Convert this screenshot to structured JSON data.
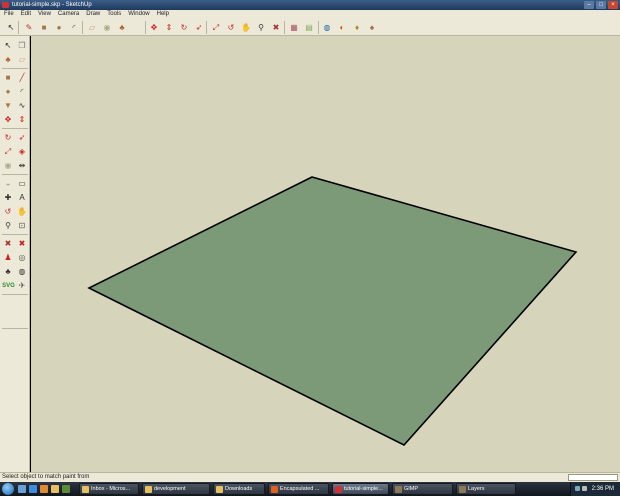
{
  "window": {
    "title": "tutorial-simple.skp - SketchUp"
  },
  "menu": [
    "File",
    "Edit",
    "View",
    "Camera",
    "Draw",
    "Tools",
    "Window",
    "Help"
  ],
  "toolbar_top": [
    {
      "icon": "select-icon",
      "glyph": "↖",
      "color": "#222"
    },
    {
      "icon": "pencil-icon",
      "glyph": "✎",
      "color": "#b33"
    },
    {
      "icon": "rectangle-icon",
      "glyph": "■",
      "color": "#a6764a"
    },
    {
      "icon": "circle-icon",
      "glyph": "●",
      "color": "#a6764a"
    },
    {
      "icon": "arc-icon",
      "glyph": "◜",
      "color": "#333"
    },
    {
      "icon": "eraser-icon",
      "glyph": "▱",
      "color": "#d88"
    },
    {
      "icon": "tape-measure-icon",
      "glyph": "◉",
      "color": "#aa8"
    },
    {
      "icon": "paint-bucket-icon",
      "glyph": "♣",
      "color": "#a63"
    },
    {
      "icon": "move-icon",
      "glyph": "✥",
      "color": "#c22"
    },
    {
      "icon": "push-pull-icon",
      "glyph": "⇕",
      "color": "#c22"
    },
    {
      "icon": "rotate-icon",
      "glyph": "↻",
      "color": "#c22"
    },
    {
      "icon": "follow-me-icon",
      "glyph": "➶",
      "color": "#c22"
    },
    {
      "icon": "scale-icon",
      "glyph": "⤢",
      "color": "#c22"
    },
    {
      "icon": "orbit-icon",
      "glyph": "↺",
      "color": "#c22"
    },
    {
      "icon": "pan-icon",
      "glyph": "✋",
      "color": "#555"
    },
    {
      "icon": "zoom-icon",
      "glyph": "⚲",
      "color": "#333"
    },
    {
      "icon": "zoom-extents-icon",
      "glyph": "✖",
      "color": "#a33"
    },
    {
      "icon": "components-icon",
      "glyph": "▦",
      "color": "#a56"
    },
    {
      "icon": "materials-icon",
      "glyph": "▤",
      "color": "#8a6"
    },
    {
      "icon": "google-earth-icon",
      "glyph": "◍",
      "color": "#26a"
    },
    {
      "icon": "photo-textures-icon",
      "glyph": "◐",
      "color": "#c50"
    },
    {
      "icon": "get-models-icon",
      "glyph": "♦",
      "color": "#a82"
    },
    {
      "icon": "share-model-icon",
      "glyph": "♠",
      "color": "#963"
    }
  ],
  "toolbar_left": [
    {
      "icon": "select-icon",
      "glyph": "↖",
      "color": "#222"
    },
    {
      "icon": "make-component-icon",
      "glyph": "❒",
      "color": "#777"
    },
    {
      "icon": "paint-bucket-icon",
      "glyph": "♣",
      "color": "#a63"
    },
    {
      "icon": "eraser-icon",
      "glyph": "▱",
      "color": "#d88"
    },
    {
      "icon": "rectangle-icon",
      "glyph": "■",
      "color": "#a6764a"
    },
    {
      "icon": "line-icon",
      "glyph": "╱",
      "color": "#b33"
    },
    {
      "icon": "circle-icon",
      "glyph": "●",
      "color": "#a6764a"
    },
    {
      "icon": "arc-icon",
      "glyph": "◜",
      "color": "#333"
    },
    {
      "icon": "polygon-icon",
      "glyph": "▼",
      "color": "#a6764a"
    },
    {
      "icon": "freehand-icon",
      "glyph": "∿",
      "color": "#333"
    },
    {
      "icon": "move-icon",
      "glyph": "✥",
      "color": "#c22"
    },
    {
      "icon": "push-pull-icon",
      "glyph": "⇕",
      "color": "#c22"
    },
    {
      "icon": "rotate-icon",
      "glyph": "↻",
      "color": "#c22"
    },
    {
      "icon": "follow-me-icon",
      "glyph": "➶",
      "color": "#c22"
    },
    {
      "icon": "scale-icon",
      "glyph": "⤢",
      "color": "#c22"
    },
    {
      "icon": "offset-icon",
      "glyph": "◈",
      "color": "#c22"
    },
    {
      "icon": "tape-measure-icon",
      "glyph": "◉",
      "color": "#aa8"
    },
    {
      "icon": "dimension-icon",
      "glyph": "⇹",
      "color": "#333"
    },
    {
      "icon": "protractor-icon",
      "glyph": "◒",
      "color": "#aa8"
    },
    {
      "icon": "text-icon",
      "glyph": "▭",
      "color": "#333"
    },
    {
      "icon": "axes-icon",
      "glyph": "✚",
      "color": "#333"
    },
    {
      "icon": "3d-text-icon",
      "glyph": "A",
      "color": "#333"
    },
    {
      "icon": "orbit-icon",
      "glyph": "↺",
      "color": "#c22"
    },
    {
      "icon": "pan-icon",
      "glyph": "✋",
      "color": "#555"
    },
    {
      "icon": "zoom-icon",
      "glyph": "⚲",
      "color": "#333"
    },
    {
      "icon": "zoom-window-icon",
      "glyph": "⊡",
      "color": "#555"
    },
    {
      "icon": "zoom-extents-icon",
      "glyph": "✖",
      "color": "#a33"
    },
    {
      "icon": "previous-view-icon",
      "glyph": "✖",
      "color": "#c22"
    },
    {
      "icon": "position-camera-icon",
      "glyph": "♟",
      "color": "#c22"
    },
    {
      "icon": "look-around-icon",
      "glyph": "◎",
      "color": "#555"
    },
    {
      "icon": "walk-icon",
      "glyph": "♣",
      "color": "#333"
    },
    {
      "icon": "section-plane-icon",
      "glyph": "◍",
      "color": "#333"
    },
    {
      "icon": "svg-export-icon",
      "glyph": "SVG",
      "color": "#2a8a2a"
    },
    {
      "icon": "sandbox-icon",
      "glyph": "✈",
      "color": "#555"
    }
  ],
  "viewport": {
    "background": "#d7d4bc",
    "face_color": "#7d9a78",
    "edge_color": "#000000"
  },
  "status": {
    "text": "Select object to match paint from"
  },
  "taskbar": {
    "tasks": [
      {
        "label": "Inbox - Micros...",
        "icon_color": "#e8c060"
      },
      {
        "label": "development",
        "icon_color": "#e8c060"
      },
      {
        "label": "Downloads",
        "icon_color": "#e8c060"
      },
      {
        "label": "Encapsulated ...",
        "icon_color": "#e06020"
      },
      {
        "label": "tutorial-simple...",
        "icon_color": "#c33"
      },
      {
        "label": "GIMP",
        "icon_color": "#8a7a5a"
      },
      {
        "label": "Layers",
        "icon_color": "#8a7a5a"
      }
    ],
    "clock": "2:36 PM"
  }
}
